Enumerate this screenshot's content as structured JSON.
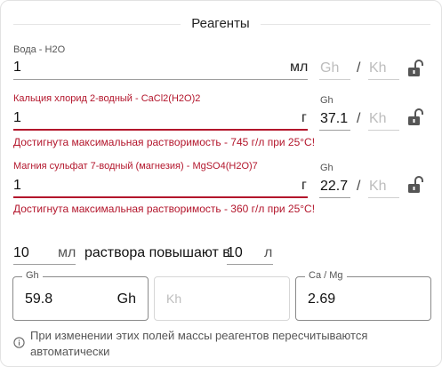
{
  "title": "Реагенты",
  "water": {
    "label": "Вода - H2O",
    "value": "1",
    "unit": "мл",
    "gh_placeholder": "Gh",
    "slash": "/",
    "kh_placeholder": "Kh"
  },
  "calcium": {
    "label": "Кальция хлорид 2-водный - CaCl2(H2O)2",
    "value": "1",
    "unit": "г",
    "gh_label": "Gh",
    "gh_value": "37.1",
    "slash": "/",
    "kh_placeholder": "Kh",
    "error": "Достигнута максимальная растворимость - 745 г/л при 25°C!"
  },
  "magnesium": {
    "label": "Магния сульфат 7-водный (магнезия) - MgSO4(H2O)7",
    "value": "1",
    "unit": "г",
    "gh_label": "Gh",
    "gh_value": "22.7",
    "slash": "/",
    "kh_placeholder": "Kh",
    "error": "Достигнута максимальная растворимость - 360 г/л при 25°C!"
  },
  "solution": {
    "volume_value": "10",
    "volume_unit": "мл",
    "text": "раствора повышают в",
    "target_value": "10",
    "target_unit": "л"
  },
  "results": {
    "gh": {
      "label": "Gh",
      "value": "59.8",
      "unit": "Gh"
    },
    "kh": {
      "placeholder": "Kh"
    },
    "camg": {
      "label": "Ca / Mg",
      "value": "2.69"
    }
  },
  "info": {
    "text_line1": "При изменении этих полей массы реагентов пересчитываются",
    "text_line2": "автоматически"
  },
  "colors": {
    "error": "#b3162c",
    "lock": "#555555"
  }
}
